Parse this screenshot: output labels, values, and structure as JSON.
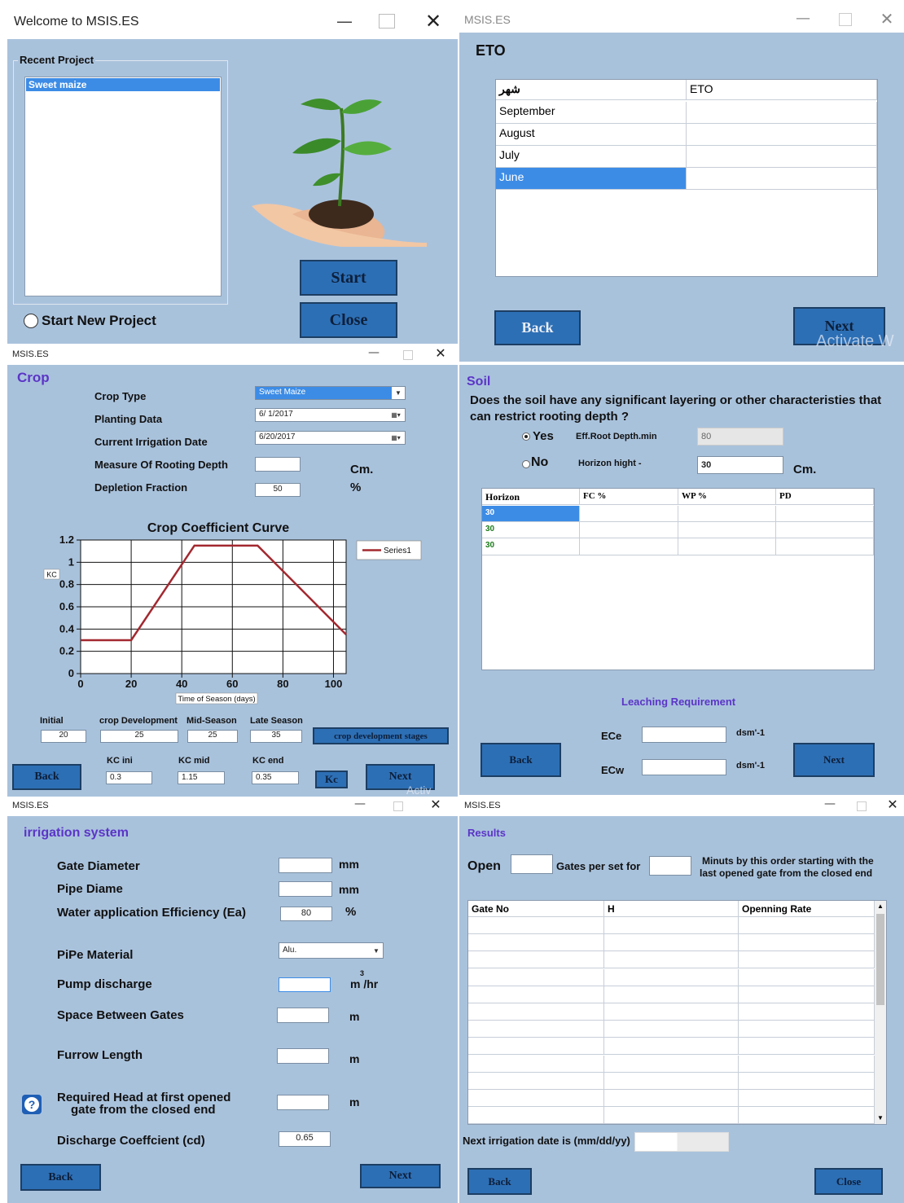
{
  "colors": {
    "window_bg": "#a9c2dc",
    "button": "#2d6fb5",
    "section": "#5b35c7",
    "selection": "#3c8ce6"
  },
  "win1": {
    "title": "Welcome to MSIS.ES",
    "recent_label": "Recent Project",
    "recent_items": [
      "Sweet maize"
    ],
    "new_project": "Start New Project",
    "start": "Start",
    "close": "Close"
  },
  "win2": {
    "title": "MSIS.ES",
    "heading": "ETO",
    "col1": "شهر",
    "col2": "ETO",
    "rows": [
      "September",
      "August",
      "July",
      "June"
    ],
    "back": "Back",
    "next": "Next",
    "watermark": "Activate W"
  },
  "win3": {
    "title": "MSIS.ES",
    "heading": "Crop",
    "crop_type_label": "Crop Type",
    "crop_type_value": "Sweet Maize",
    "planting_label": "Planting Data",
    "planting_value": "6/ 1/2017",
    "irrigation_label": "Current Irrigation Date",
    "irrigation_value": "6/20/2017",
    "rooting_label": "Measure Of Rooting Depth",
    "rooting_unit": "Cm.",
    "depletion_label": "Depletion Fraction",
    "depletion_value": "50",
    "depletion_unit": "%",
    "stage_labels": [
      "Initial",
      "crop Development",
      "Mid-Season",
      "Late Season"
    ],
    "stage_values": [
      "20",
      "25",
      "25",
      "35"
    ],
    "stages_button": "crop development stages",
    "kc_labels": [
      "KC ini",
      "KC mid",
      "KC end"
    ],
    "kc_values": [
      "0.3",
      "1.15",
      "0.35"
    ],
    "kc_button": "Kc",
    "back": "Back",
    "next": "Next",
    "watermark": "Activ"
  },
  "chart_data": {
    "type": "line",
    "title": "Crop Coefficient Curve",
    "xlabel": "Time of Season (days)",
    "ylabel": "KC",
    "x": [
      0,
      20,
      45,
      70,
      105
    ],
    "series": [
      {
        "name": "Series1",
        "values": [
          0.3,
          0.3,
          1.15,
          1.15,
          0.35
        ]
      }
    ],
    "xlim": [
      0,
      105
    ],
    "ylim": [
      0,
      1.2
    ],
    "xticks": [
      0,
      20,
      40,
      60,
      80,
      100
    ],
    "yticks": [
      0,
      0.2,
      0.4,
      0.6,
      0.8,
      1,
      1.2
    ],
    "xtick_labels": [
      "0",
      "20",
      "40",
      "60",
      "80",
      "100"
    ],
    "ytick_labels": [
      "0",
      "0.2",
      "0.4",
      "0.6",
      "0.8",
      "1",
      "1.2"
    ],
    "grid": true,
    "legend": "top-right",
    "color": "#a3282f"
  },
  "win4": {
    "title": "",
    "heading": "Soil",
    "question": "Does the soil have any significant layering or other characteristies that can restrict rooting depth ?",
    "yes": "Yes",
    "no": "No",
    "eff_label": "Eff.Root Depth.min",
    "eff_value": "80",
    "horizon_label": "Horizon hight -",
    "horizon_value": "30",
    "horizon_unit": "Cm.",
    "columns": [
      "Horizon",
      "FC %",
      "WP %",
      "PD"
    ],
    "rows": [
      "30",
      "30",
      "30"
    ],
    "leaching": "Leaching Requirement",
    "ece": "ECe",
    "ecw": "ECw",
    "ec_unit": "dsm'-1",
    "back": "Back",
    "next": "Next"
  },
  "win5": {
    "title": "MSIS.ES",
    "heading": "irrigation system",
    "gate_diameter": "Gate Diameter",
    "pipe_diame": "Pipe Diame",
    "ea_label": "Water application Efficiency (Ea)",
    "ea_value": "80",
    "pipe_material": "PiPe Material",
    "pipe_material_value": "Alu.",
    "pump": "Pump discharge",
    "pump_unit": "m /hr",
    "pump_unit_sup": "3",
    "space": "Space Between Gates",
    "furrow": "Furrow Length",
    "head_line1": "Required Head at first opened",
    "head_line2": "gate from the closed end",
    "cd_label": "Discharge Coeffcient (cd)",
    "cd_value": "0.65",
    "mm": "mm",
    "pct": "%",
    "m": "m",
    "help": "?",
    "back": "Back",
    "next": "Next"
  },
  "win6": {
    "title": "MSIS.ES",
    "heading": "Results",
    "open": "Open",
    "gates_per_set": "Gates per set for",
    "minutes_line1": "Minuts by this order starting with the",
    "minutes_line2": "last opened gate from the closed end",
    "columns": [
      "Gate No",
      "H",
      "Openning Rate"
    ],
    "next_date": "Next irrigation date is (mm/dd/yy)",
    "back": "Back",
    "close": "Close"
  }
}
